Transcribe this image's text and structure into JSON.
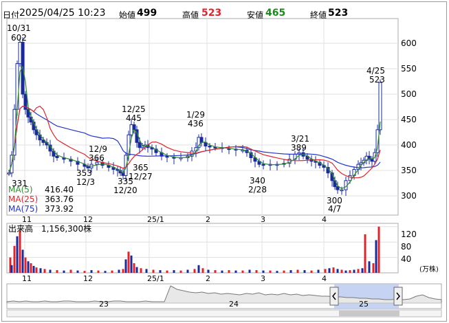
{
  "header": {
    "date_label": "日付",
    "datetime": "2025/04/25 10:23",
    "open_label": "始値",
    "open": "499",
    "high_label": "高値",
    "high": "523",
    "low_label": "安値",
    "low": "465",
    "close_label": "終値",
    "close": "523"
  },
  "legend": {
    "ma5_label": "MA(5)",
    "ma5_value": "416.40",
    "ma5_color": "#2f8a2f",
    "ma25_label": "MA(25)",
    "ma25_value": "363.76",
    "ma25_color": "#e0232a",
    "ma75_label": "MA(75)",
    "ma75_value": "373.92",
    "ma75_color": "#2233cc"
  },
  "annotations": {
    "peak_date": "10/31",
    "peak_value": "602",
    "start_low": "331",
    "dec9_date": "12/9",
    "dec9_value": "366",
    "dec3_value": "353",
    "dec3_date": "12/3",
    "dec25_date": "12/25",
    "dec25_value": "445",
    "dec27_a": "365",
    "dec27_b": "12/27",
    "dec20_value": "335",
    "dec20_date": "12/20",
    "jan29_date": "1/29",
    "jan29_value": "436",
    "feb28_value": "340",
    "feb28_date": "2/28",
    "mar21_date": "3/21",
    "mar21_value": "389",
    "apr7_value": "300",
    "apr7_date": "4/7",
    "apr25_date": "4/25",
    "apr25_value": "523"
  },
  "price_axis": [
    "600",
    "550",
    "500",
    "450",
    "400",
    "350",
    "300"
  ],
  "month_labels": [
    "11",
    "12",
    "25/1",
    "2",
    "3",
    "4"
  ],
  "volume": {
    "title": "出来高",
    "value": "1,156,300株",
    "axis": [
      "120",
      "80",
      "40"
    ],
    "unit": "(万株)"
  },
  "navigator": {
    "years": [
      "23",
      "24",
      "25"
    ],
    "left_handle_icon": "chevron-left-icon",
    "right_handle_icon": "chevron-right-icon"
  },
  "colors": {
    "candle": "#1a2a9a",
    "up_volume": "#e0232a",
    "down_volume": "#1a2a9a",
    "grid": "#d0d0d0",
    "nav_selection": "#b8c8f0"
  }
}
